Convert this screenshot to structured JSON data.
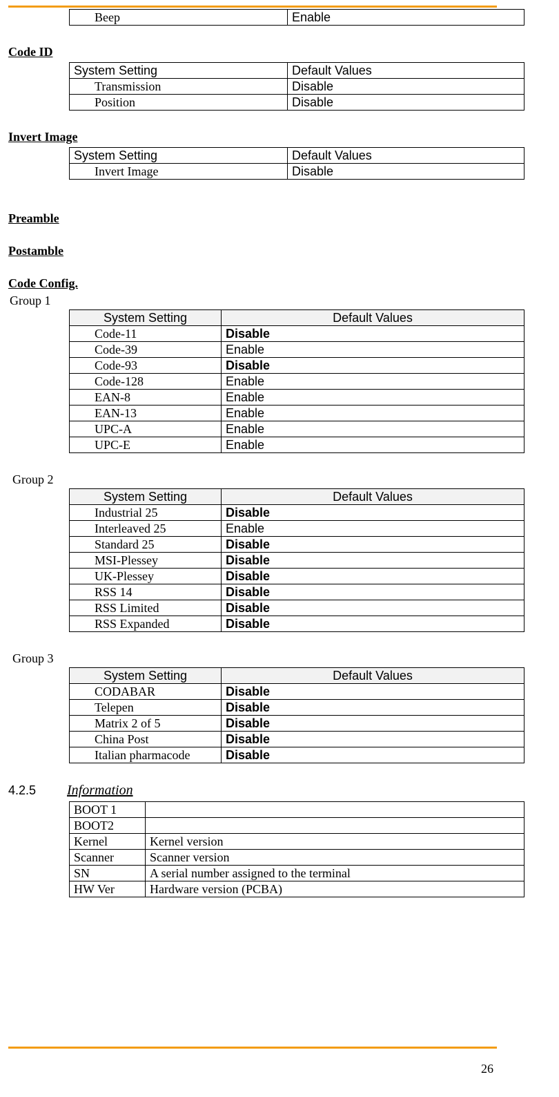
{
  "page_number": "26",
  "beep_table": {
    "rows": [
      {
        "setting": "Beep",
        "value": "Enable"
      }
    ]
  },
  "section_code_id": {
    "title": "Code ID",
    "header": {
      "c1": "System Setting",
      "c2": "Default Values"
    },
    "rows": [
      {
        "setting": "Transmission",
        "value": "Disable"
      },
      {
        "setting": "Position",
        "value": "Disable"
      }
    ]
  },
  "section_invert": {
    "title": "Invert Image",
    "header": {
      "c1": "System Setting",
      "c2": "Default Values"
    },
    "rows": [
      {
        "setting": "Invert Image",
        "value": "Disable"
      }
    ]
  },
  "section_preamble": {
    "title": "Preamble"
  },
  "section_postamble": {
    "title": "Postamble"
  },
  "section_codeconfig": {
    "title": "Code Config.",
    "group1": {
      "label": "Group 1",
      "header": {
        "c1": "System Setting",
        "c2": "Default Values"
      },
      "rows": [
        {
          "setting": "Code-11",
          "value": "Disable",
          "bold": true
        },
        {
          "setting": "Code-39",
          "value": "Enable",
          "bold": false
        },
        {
          "setting": "Code-93",
          "value": "Disable",
          "bold": true
        },
        {
          "setting": "Code-128",
          "value": "Enable",
          "bold": false
        },
        {
          "setting": "EAN-8",
          "value": "Enable",
          "bold": false
        },
        {
          "setting": "EAN-13",
          "value": "Enable",
          "bold": false
        },
        {
          "setting": "UPC-A",
          "value": "Enable",
          "bold": false
        },
        {
          "setting": "UPC-E",
          "value": "Enable",
          "bold": false
        }
      ]
    },
    "group2": {
      "label": "Group 2",
      "header": {
        "c1": "System Setting",
        "c2": "Default Values"
      },
      "rows": [
        {
          "setting": "Industrial 25",
          "value": "Disable",
          "bold": true
        },
        {
          "setting": "Interleaved 25",
          "value": "Enable",
          "bold": false
        },
        {
          "setting": "Standard 25",
          "value": "Disable",
          "bold": true
        },
        {
          "setting": "MSI-Plessey",
          "value": "Disable",
          "bold": true
        },
        {
          "setting": "UK-Plessey",
          "value": "Disable",
          "bold": true
        },
        {
          "setting": "RSS 14",
          "value": "Disable",
          "bold": true
        },
        {
          "setting": "RSS Limited",
          "value": "Disable",
          "bold": true
        },
        {
          "setting": "RSS Expanded",
          "value": "Disable",
          "bold": true
        }
      ]
    },
    "group3": {
      "label": "Group 3",
      "header": {
        "c1": "System Setting",
        "c2": "Default Values"
      },
      "rows": [
        {
          "setting": "CODABAR",
          "value": "Disable",
          "bold": true
        },
        {
          "setting": "Telepen",
          "value": "Disable",
          "bold": true
        },
        {
          "setting": "Matrix 2 of 5",
          "value": "Disable",
          "bold": true
        },
        {
          "setting": "China Post",
          "value": "Disable",
          "bold": true
        },
        {
          "setting": "Italian pharmacode",
          "value": "Disable",
          "bold": true
        }
      ]
    }
  },
  "section_info": {
    "number": "4.2.5",
    "title": "Information",
    "rows": [
      {
        "k": "BOOT 1",
        "v": ""
      },
      {
        "k": "BOOT2",
        "v": ""
      },
      {
        "k": "Kernel",
        "v": "Kernel version"
      },
      {
        "k": "Scanner",
        "v": "Scanner version"
      },
      {
        "k": "SN",
        "v": "A serial number assigned to the terminal"
      },
      {
        "k": "HW Ver",
        "v": "Hardware version (PCBA)"
      }
    ]
  }
}
